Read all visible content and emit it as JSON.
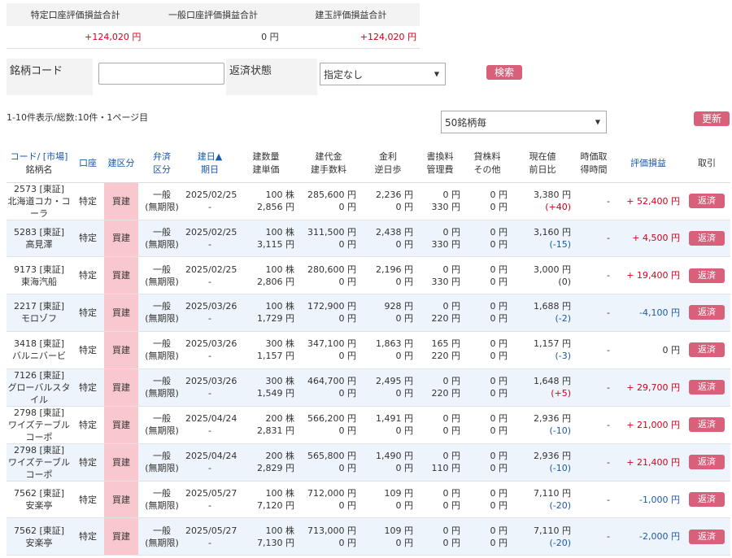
{
  "summary": {
    "headers": [
      "特定口座評価損益合計",
      "一般口座評価損益合計",
      "建玉評価損益合計"
    ],
    "values": [
      "+124,020 円",
      "0 円",
      "+124,020 円"
    ]
  },
  "search": {
    "code_label": "銘柄コード",
    "code_value": "",
    "status_label": "返済状態",
    "status_value": "指定なし",
    "search_button": "検索"
  },
  "list_info": {
    "page_text": "1-10件表示/総数:10件・1ページ目",
    "per_page": "50銘柄毎",
    "refresh_button": "更新"
  },
  "columns": {
    "code": [
      "コード/ [市場]",
      "銘柄名"
    ],
    "account": [
      "口座"
    ],
    "side": [
      "建区分"
    ],
    "repay": [
      "弁済",
      "区分"
    ],
    "date": [
      "建日▲",
      "期日"
    ],
    "qty": [
      "建数量",
      "建単価"
    ],
    "amount": [
      "建代金",
      "建手数料"
    ],
    "interest": [
      "金利",
      "逆日歩"
    ],
    "fee": [
      "書換料",
      "管理費"
    ],
    "lend": [
      "貸株料",
      "その他"
    ],
    "price": [
      "現在値",
      "前日比"
    ],
    "time": [
      "時価取",
      "得時間"
    ],
    "pl": [
      "評価損益"
    ],
    "trade": [
      "取引"
    ]
  },
  "rows": [
    {
      "code": "2573 [東証]",
      "name": "北海道コカ・コーラ",
      "account": "特定",
      "side": "買建",
      "repay1": "一般",
      "repay2": "(無期限)",
      "date": "2025/02/25",
      "due": "-",
      "qty": "100 株",
      "unit": "2,856 円",
      "amount": "285,600 円",
      "fee_open": "0 円",
      "interest": "2,236 円",
      "rev": "0 円",
      "rewrite": "0 円",
      "mgmt": "330 円",
      "lend": "0 円",
      "other": "0 円",
      "price": "3,380 円",
      "change": "(+40)",
      "change_dir": "up",
      "time": "-",
      "pl": "+ 52,400 円",
      "pl_dir": "up",
      "action": "返済"
    },
    {
      "code": "5283 [東証]",
      "name": "高見澤",
      "account": "特定",
      "side": "買建",
      "repay1": "一般",
      "repay2": "(無期限)",
      "date": "2025/02/25",
      "due": "-",
      "qty": "100 株",
      "unit": "3,115 円",
      "amount": "311,500 円",
      "fee_open": "0 円",
      "interest": "2,438 円",
      "rev": "0 円",
      "rewrite": "0 円",
      "mgmt": "330 円",
      "lend": "0 円",
      "other": "0 円",
      "price": "3,160 円",
      "change": "(-15)",
      "change_dir": "down",
      "time": "-",
      "pl": "+ 4,500 円",
      "pl_dir": "up",
      "action": "返済"
    },
    {
      "code": "9173 [東証]",
      "name": "東海汽船",
      "account": "特定",
      "side": "買建",
      "repay1": "一般",
      "repay2": "(無期限)",
      "date": "2025/02/25",
      "due": "-",
      "qty": "100 株",
      "unit": "2,806 円",
      "amount": "280,600 円",
      "fee_open": "0 円",
      "interest": "2,196 円",
      "rev": "0 円",
      "rewrite": "0 円",
      "mgmt": "330 円",
      "lend": "0 円",
      "other": "0 円",
      "price": "3,000 円",
      "change": "(0)",
      "change_dir": "flat",
      "time": "-",
      "pl": "+ 19,400 円",
      "pl_dir": "up",
      "action": "返済"
    },
    {
      "code": "2217 [東証]",
      "name": "モロゾフ",
      "account": "特定",
      "side": "買建",
      "repay1": "一般",
      "repay2": "(無期限)",
      "date": "2025/03/26",
      "due": "-",
      "qty": "100 株",
      "unit": "1,729 円",
      "amount": "172,900 円",
      "fee_open": "0 円",
      "interest": "928 円",
      "rev": "0 円",
      "rewrite": "0 円",
      "mgmt": "220 円",
      "lend": "0 円",
      "other": "0 円",
      "price": "1,688 円",
      "change": "(-2)",
      "change_dir": "down",
      "time": "-",
      "pl": "-4,100 円",
      "pl_dir": "down",
      "action": "返済"
    },
    {
      "code": "3418 [東証]",
      "name": "バルニバービ",
      "account": "特定",
      "side": "買建",
      "repay1": "一般",
      "repay2": "(無期限)",
      "date": "2025/03/26",
      "due": "-",
      "qty": "300 株",
      "unit": "1,157 円",
      "amount": "347,100 円",
      "fee_open": "0 円",
      "interest": "1,863 円",
      "rev": "0 円",
      "rewrite": "165 円",
      "mgmt": "220 円",
      "lend": "0 円",
      "other": "0 円",
      "price": "1,157 円",
      "change": "(-3)",
      "change_dir": "down",
      "time": "-",
      "pl": "0 円",
      "pl_dir": "flat",
      "action": "返済"
    },
    {
      "code": "7126 [東証]",
      "name": "グローバルスタイル",
      "account": "特定",
      "side": "買建",
      "repay1": "一般",
      "repay2": "(無期限)",
      "date": "2025/03/26",
      "due": "-",
      "qty": "300 株",
      "unit": "1,549 円",
      "amount": "464,700 円",
      "fee_open": "0 円",
      "interest": "2,495 円",
      "rev": "0 円",
      "rewrite": "0 円",
      "mgmt": "220 円",
      "lend": "0 円",
      "other": "0 円",
      "price": "1,648 円",
      "change": "(+5)",
      "change_dir": "up",
      "time": "-",
      "pl": "+ 29,700 円",
      "pl_dir": "up",
      "action": "返済"
    },
    {
      "code": "2798 [東証]",
      "name": "ワイズテーブルコーポ",
      "account": "特定",
      "side": "買建",
      "repay1": "一般",
      "repay2": "(無期限)",
      "date": "2025/04/24",
      "due": "-",
      "qty": "200 株",
      "unit": "2,831 円",
      "amount": "566,200 円",
      "fee_open": "0 円",
      "interest": "1,491 円",
      "rev": "0 円",
      "rewrite": "0 円",
      "mgmt": "0 円",
      "lend": "0 円",
      "other": "0 円",
      "price": "2,936 円",
      "change": "(-10)",
      "change_dir": "down",
      "time": "-",
      "pl": "+ 21,000 円",
      "pl_dir": "up",
      "action": "返済"
    },
    {
      "code": "2798 [東証]",
      "name": "ワイズテーブルコーポ",
      "account": "特定",
      "side": "買建",
      "repay1": "一般",
      "repay2": "(無期限)",
      "date": "2025/04/24",
      "due": "-",
      "qty": "200 株",
      "unit": "2,829 円",
      "amount": "565,800 円",
      "fee_open": "0 円",
      "interest": "1,490 円",
      "rev": "0 円",
      "rewrite": "0 円",
      "mgmt": "110 円",
      "lend": "0 円",
      "other": "0 円",
      "price": "2,936 円",
      "change": "(-10)",
      "change_dir": "down",
      "time": "-",
      "pl": "+ 21,400 円",
      "pl_dir": "up",
      "action": "返済"
    },
    {
      "code": "7562 [東証]",
      "name": "安楽亭",
      "account": "特定",
      "side": "買建",
      "repay1": "一般",
      "repay2": "(無期限)",
      "date": "2025/05/27",
      "due": "-",
      "qty": "100 株",
      "unit": "7,120 円",
      "amount": "712,000 円",
      "fee_open": "0 円",
      "interest": "109 円",
      "rev": "0 円",
      "rewrite": "0 円",
      "mgmt": "0 円",
      "lend": "0 円",
      "other": "0 円",
      "price": "7,110 円",
      "change": "(-20)",
      "change_dir": "down",
      "time": "-",
      "pl": "-1,000 円",
      "pl_dir": "down",
      "action": "返済"
    },
    {
      "code": "7562 [東証]",
      "name": "安楽亭",
      "account": "特定",
      "side": "買建",
      "repay1": "一般",
      "repay2": "(無期限)",
      "date": "2025/05/27",
      "due": "-",
      "qty": "100 株",
      "unit": "7,130 円",
      "amount": "713,000 円",
      "fee_open": "0 円",
      "interest": "109 円",
      "rev": "0 円",
      "rewrite": "0 円",
      "mgmt": "0 円",
      "lend": "0 円",
      "other": "0 円",
      "price": "7,110 円",
      "change": "(-20)",
      "change_dir": "down",
      "time": "-",
      "pl": "-2,000 円",
      "pl_dir": "down",
      "action": "返済"
    }
  ],
  "colors": {
    "up": "#d0021b",
    "down": "#1a5aa8",
    "flat": "#333333",
    "accent_button": "#d9607a",
    "buy_cell": "#f8c8ce"
  }
}
